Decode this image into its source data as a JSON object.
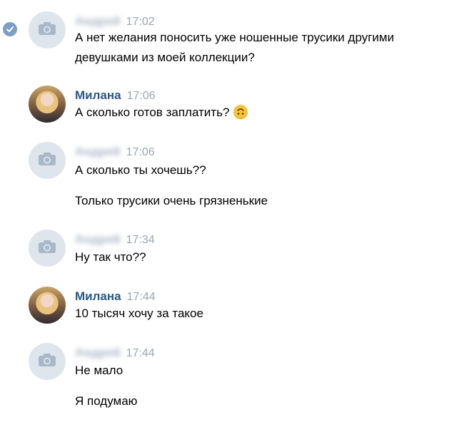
{
  "messages": [
    {
      "sender": "Андрей",
      "time": "17:02",
      "blurred_name": true,
      "avatar": "camera-icon",
      "read_marker": "check-icon",
      "lines": [
        "А нет желания поносить уже ношенные трусики другими",
        "девушками из моей коллекции?"
      ]
    },
    {
      "sender": "Милана",
      "time": "17:06",
      "blurred_name": false,
      "avatar": "user-photo",
      "lines": [
        "А сколько готов заплатить?"
      ],
      "emoji": "upside-down-face-icon"
    },
    {
      "sender": "Андрей",
      "time": "17:06",
      "blurred_name": true,
      "avatar": "camera-icon",
      "lines": [
        "А сколько ты хочешь??",
        "Только трусики очень грязненькие"
      ]
    },
    {
      "sender": "Андрей",
      "time": "17:34",
      "blurred_name": true,
      "avatar": "camera-icon",
      "lines": [
        "Ну так что??"
      ]
    },
    {
      "sender": "Милана",
      "time": "17:44",
      "blurred_name": false,
      "avatar": "user-photo",
      "lines": [
        "10 тысяч хочу за такое"
      ]
    },
    {
      "sender": "Андрей",
      "time": "17:44",
      "blurred_name": true,
      "avatar": "camera-icon",
      "lines": [
        "Не мало",
        "Я подумаю"
      ]
    }
  ],
  "colors": {
    "name": "#2a5885",
    "time": "#9aa5b1",
    "avatar_placeholder": "#dfe5ec",
    "read_check": "#7d9fc6"
  }
}
